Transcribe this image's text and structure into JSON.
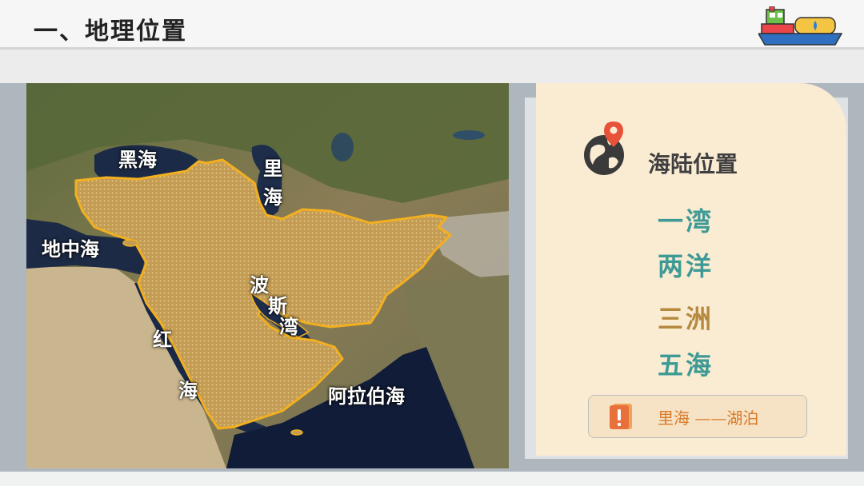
{
  "header": {
    "title": "一、地理位置"
  },
  "map": {
    "labels": {
      "black_sea": "黑海",
      "caspian_1": "里",
      "caspian_2": "海",
      "mediterranean": "地中海",
      "persian_1": "波",
      "persian_2": "斯",
      "persian_3": "湾",
      "red_1": "红",
      "red_2": "海",
      "arabian": "阿拉伯海"
    }
  },
  "panel": {
    "heading": "海陆位置",
    "items": [
      {
        "text": "一湾",
        "color": "#3d9a94"
      },
      {
        "text": "两洋",
        "color": "#3d9a94"
      },
      {
        "text": "三洲",
        "color": "#b58a3f"
      },
      {
        "text": "五海",
        "color": "#3d9a94"
      }
    ],
    "note": "里海 ——湖泊"
  },
  "colors": {
    "highlight_region": "#c9a155",
    "highlight_border": "#f2b021",
    "card_bg": "#faebd3",
    "accent_teal": "#3d9a94",
    "accent_gold": "#b58a3f",
    "note_text": "#d77a28"
  }
}
